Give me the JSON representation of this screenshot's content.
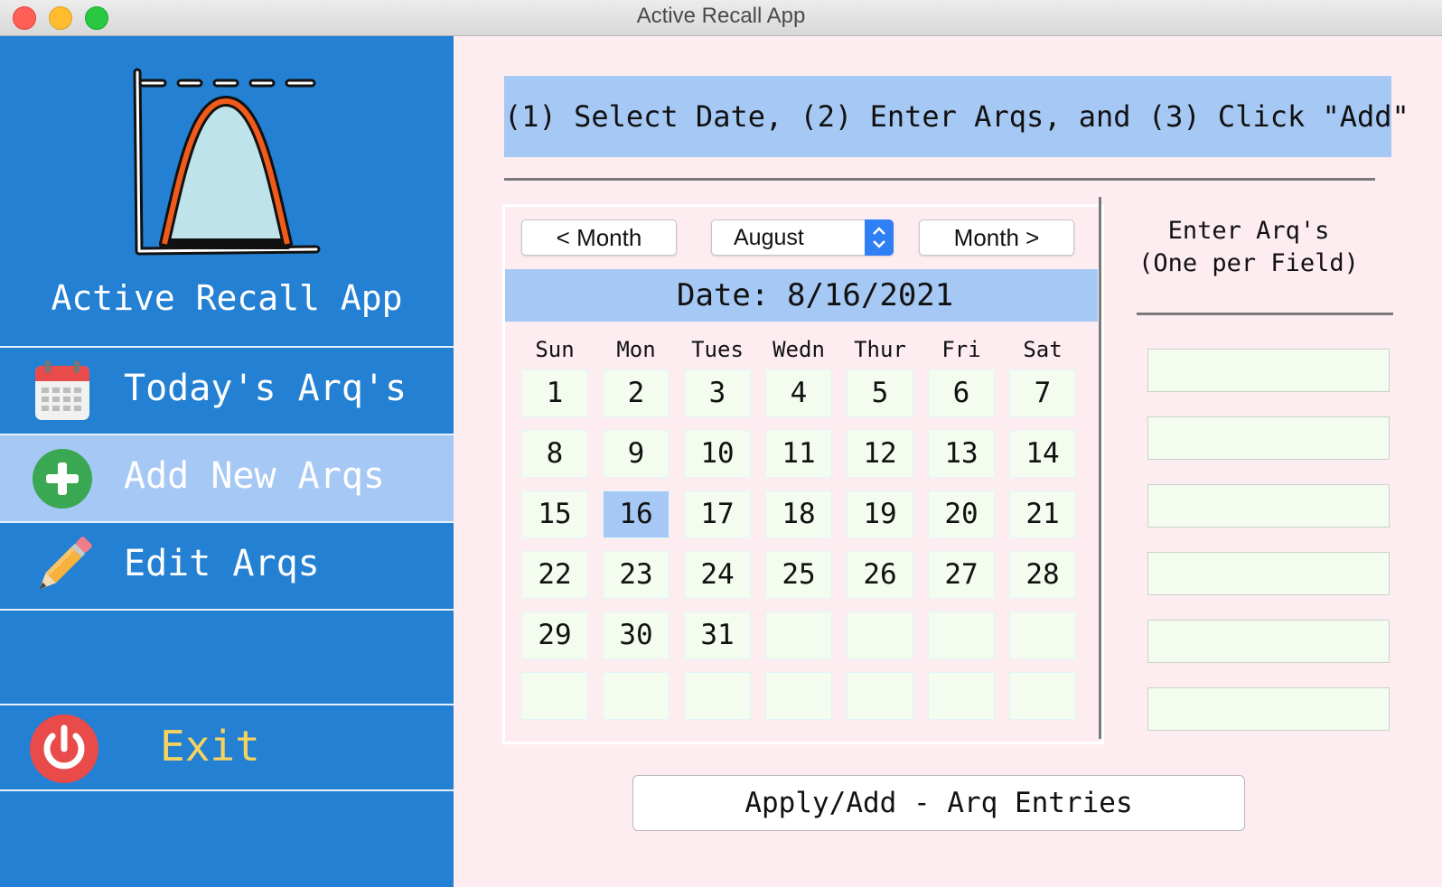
{
  "window": {
    "title": "Active Recall App"
  },
  "sidebar": {
    "app_name": "Active Recall App",
    "items": [
      {
        "label": "Today's Arq's",
        "icon": "calendar-icon",
        "active": false
      },
      {
        "label": "Add New Arqs",
        "icon": "plus-circle-icon",
        "active": true
      },
      {
        "label": "Edit Arqs",
        "icon": "pencil-icon",
        "active": false
      }
    ],
    "exit": {
      "label": "Exit",
      "icon": "power-icon"
    }
  },
  "main": {
    "instructions": "(1) Select Date, (2) Enter Arqs, and (3) Click \"Add\"",
    "calendar": {
      "prev_label": "< Month",
      "next_label": "Month >",
      "month_selected": "August",
      "date_label": "Date:",
      "date_value": "8/16/2021",
      "weekdays": [
        "Sun",
        "Mon",
        "Tues",
        "Wedn",
        "Thur",
        "Fri",
        "Sat"
      ],
      "days": [
        "1",
        "2",
        "3",
        "4",
        "5",
        "6",
        "7",
        "8",
        "9",
        "10",
        "11",
        "12",
        "13",
        "14",
        "15",
        "16",
        "17",
        "18",
        "19",
        "20",
        "21",
        "22",
        "23",
        "24",
        "25",
        "26",
        "27",
        "28",
        "29",
        "30",
        "31",
        "",
        "",
        "",
        "",
        "",
        "",
        "",
        "",
        "",
        "",
        ""
      ],
      "selected_day": "16"
    },
    "arq_panel": {
      "title_line1": "Enter Arq's",
      "title_line2": "(One per Field)",
      "fields": [
        "",
        "",
        "",
        "",
        "",
        ""
      ]
    },
    "apply_label": "Apply/Add - Arq Entries"
  },
  "colors": {
    "sidebar_bg": "#2480d3",
    "accent_light": "#a6c8f4",
    "main_bg": "#fdedf1",
    "cell_bg": "#f3fcef",
    "exit_text": "#f5d35e"
  }
}
